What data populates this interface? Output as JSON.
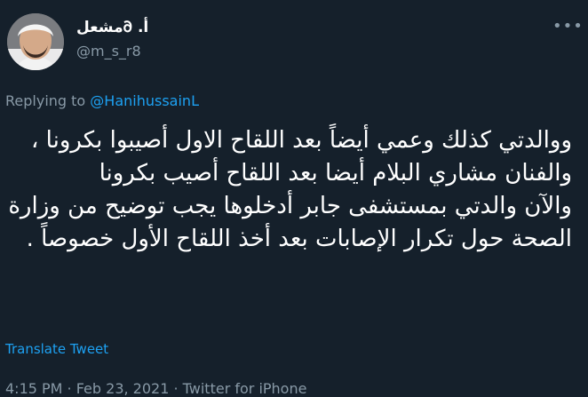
{
  "tweet": {
    "display_name": "أ. 𐐀مشعل",
    "handle": "@m_s_r8",
    "replying_prefix": "Replying to ",
    "replying_to": "@HanihussainL",
    "text": "ووالدتي كذلك وعمي أيضاً بعد اللقاح الاول أصيبوا بكرونا ، والفنان مشاري البلام أيضا بعد اللقاح أصيب بكرونا\nوالآن والدتي بمستشفى جابر أدخلوها يجب توضيح من وزارة الصحة حول تكرار الإصابات بعد أخذ اللقاح الأول خصوصاً .",
    "translate_label": "Translate Tweet",
    "meta": "4:15 PM · Feb 23, 2021 · Twitter for iPhone"
  },
  "icons": {
    "more": "more-horizontal-icon"
  },
  "colors": {
    "background": "#15202b",
    "link": "#1da1f2",
    "secondary_text": "#8899a6"
  }
}
